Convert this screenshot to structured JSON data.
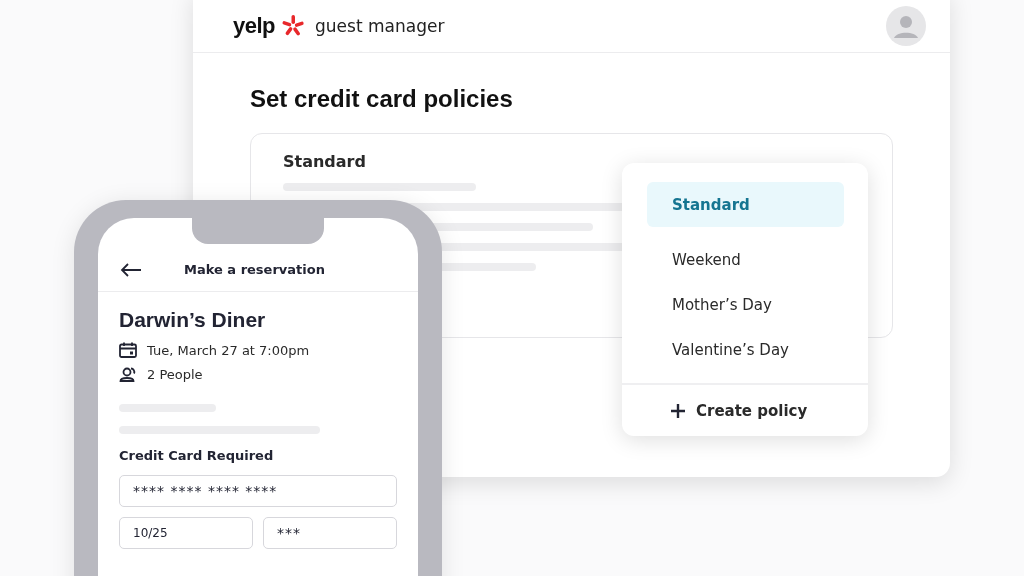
{
  "app": {
    "logo": "yelp",
    "product": "guest manager"
  },
  "page": {
    "title": "Set credit card policies",
    "policy_field": {
      "value": "Standard"
    }
  },
  "dropdown": {
    "options": [
      {
        "label": "Standard",
        "selected": true
      },
      {
        "label": "Weekend",
        "selected": false
      },
      {
        "label": "Mother’s Day",
        "selected": false
      },
      {
        "label": "Valentine’s Day",
        "selected": false
      }
    ],
    "action": "Create policy"
  },
  "phone": {
    "header": "Make a reservation",
    "restaurant": "Darwin’s Diner",
    "date": "Tue, March 27 at 7:00pm",
    "party": "2 People",
    "section": "Credit Card Required",
    "card_number": "**** **** **** ****",
    "expiry": "10/25",
    "cvv": "***"
  }
}
